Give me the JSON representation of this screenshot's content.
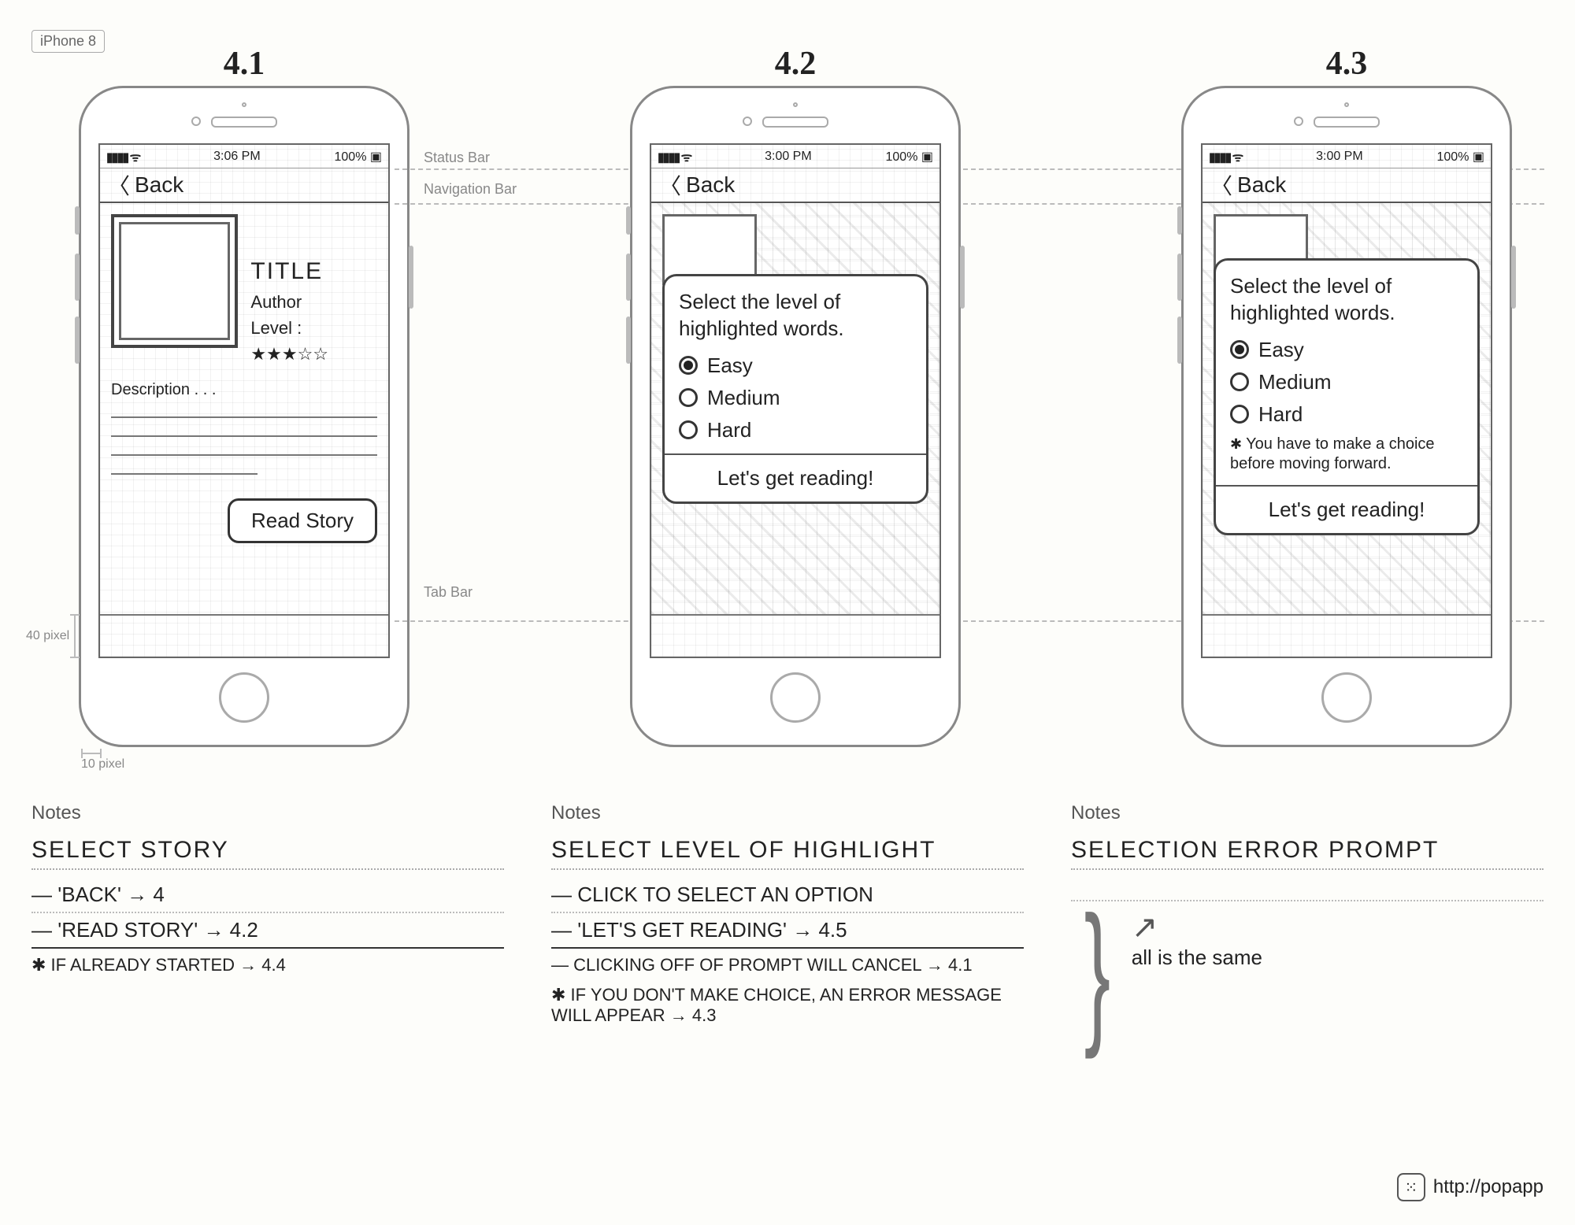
{
  "device_tag": "iPhone 8",
  "bar_labels": {
    "status": "Status Bar",
    "nav": "Navigation Bar",
    "tab": "Tab Bar"
  },
  "rulers": {
    "v": "40 pixel",
    "h": "10 pixel"
  },
  "status": {
    "signal": "▮▮▮▮ ᯤ",
    "time_1": "3:06 PM",
    "time_2": "3:00 PM",
    "time_3": "3:00 PM",
    "battery": "100% ▣"
  },
  "nav": {
    "back": "Back"
  },
  "screens": {
    "s1": {
      "num": "4.1",
      "title": "TITLE",
      "author": "Author",
      "level_label": "Level :",
      "level_stars": "★★★☆☆",
      "desc_label": "Description . . .",
      "read_btn": "Read Story"
    },
    "s2": {
      "num": "4.2",
      "prompt": "Select the level of highlighted words.",
      "opts": [
        "Easy",
        "Medium",
        "Hard"
      ],
      "cta": "Let's get reading!"
    },
    "s3": {
      "num": "4.3",
      "prompt": "Select the level of highlighted words.",
      "opts": [
        "Easy",
        "Medium",
        "Hard"
      ],
      "error": "You have to make a choice before moving forward.",
      "cta": "Let's get reading!"
    }
  },
  "notes": {
    "heading": "Notes",
    "c1": {
      "title": "SELECT STORY",
      "l1": "— 'BACK' → 4",
      "l2": "— 'READ STORY' → 4.2",
      "l3": "IF ALREADY STARTED → 4.4"
    },
    "c2": {
      "title": "SELECT LEVEL OF HIGHLIGHT",
      "l1": "— CLICK TO SELECT AN OPTION",
      "l2": "— 'LET'S GET READING' → 4.5",
      "l3": "— CLICKING OFF OF PROMPT WILL CANCEL → 4.1",
      "l4": "IF YOU DON'T MAKE CHOICE, AN ERROR MESSAGE WILL APPEAR → 4.3"
    },
    "c3": {
      "title": "SELECTION ERROR PROMPT",
      "aside": "all is the same"
    }
  },
  "footer": {
    "url": "http://popapp"
  }
}
